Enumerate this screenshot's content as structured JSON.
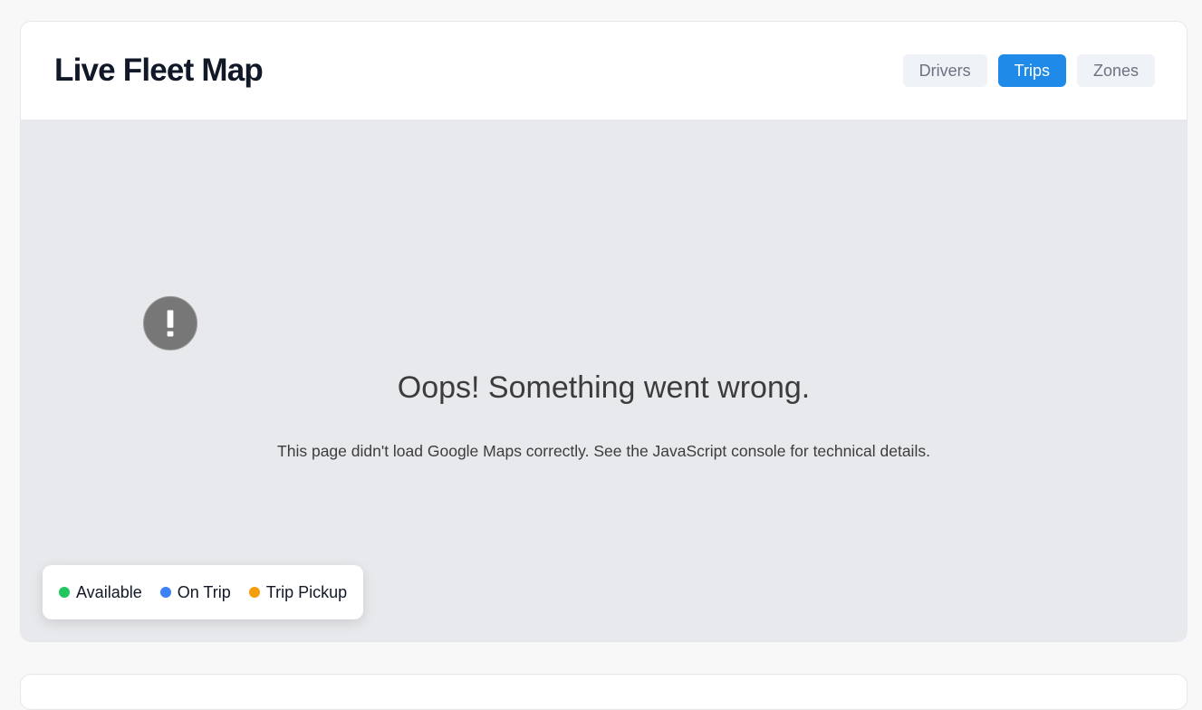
{
  "header": {
    "title": "Live Fleet Map",
    "tabs": [
      {
        "label": "Drivers",
        "active": false
      },
      {
        "label": "Trips",
        "active": true
      },
      {
        "label": "Zones",
        "active": false
      }
    ]
  },
  "map": {
    "error_title": "Oops! Something went wrong.",
    "error_message": "This page didn't load Google Maps correctly. See the JavaScript console for technical details."
  },
  "legend": {
    "items": [
      {
        "label": "Available",
        "color": "#22c55e"
      },
      {
        "label": "On Trip",
        "color": "#3b82f6"
      },
      {
        "label": "Trip Pickup",
        "color": "#f59e0b"
      }
    ]
  },
  "colors": {
    "accent": "#1f8ae8",
    "error_icon": "#777777"
  }
}
